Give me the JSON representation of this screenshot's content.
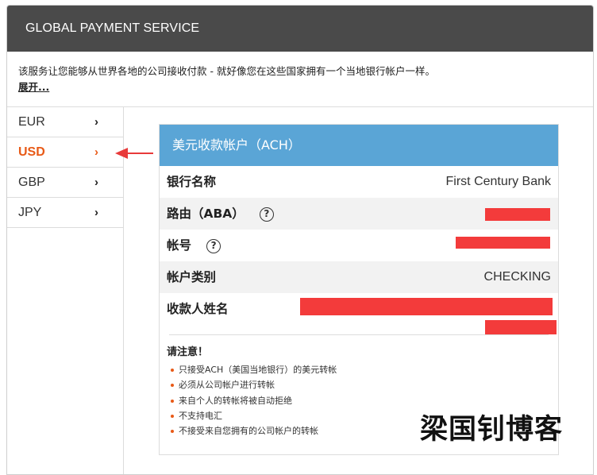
{
  "header": {
    "title": "GLOBAL PAYMENT SERVICE"
  },
  "intro": {
    "text": "该服务让您能够从世界各地的公司接收付款 - 就好像您在这些国家拥有一个当地银行帐户一样。",
    "expand_label": "展开..."
  },
  "sidebar": {
    "items": [
      {
        "label": "EUR",
        "chevron": "›",
        "active": false
      },
      {
        "label": "USD",
        "chevron": "›",
        "active": true
      },
      {
        "label": "GBP",
        "chevron": "›",
        "active": false
      },
      {
        "label": "JPY",
        "chevron": "›",
        "active": false
      }
    ]
  },
  "card": {
    "title": "美元收款帐户（ACH）",
    "rows": [
      {
        "label": "银行名称",
        "value": "First Century Bank"
      },
      {
        "label": "路由（ABA）",
        "help": "?"
      },
      {
        "label": "帐号",
        "help": "?"
      },
      {
        "label": "帐户类别",
        "value": "CHECKING"
      },
      {
        "label": "收款人姓名"
      }
    ]
  },
  "notice": {
    "title": "请注意！",
    "items": [
      "只接受ACH（美国当地银行）的美元转帐",
      "必须从公司帐户进行转帐",
      "来自个人的转帐将被自动拒绝",
      "不支持电汇",
      "不接受来自您拥有的公司帐户的转帐"
    ]
  },
  "watermark": {
    "text": "梁国钊博客"
  },
  "colors": {
    "header_bg": "#4a4a4a",
    "card_title_bg": "#5aa5d6",
    "accent": "#e85a17",
    "redaction": "#f33b3b"
  }
}
